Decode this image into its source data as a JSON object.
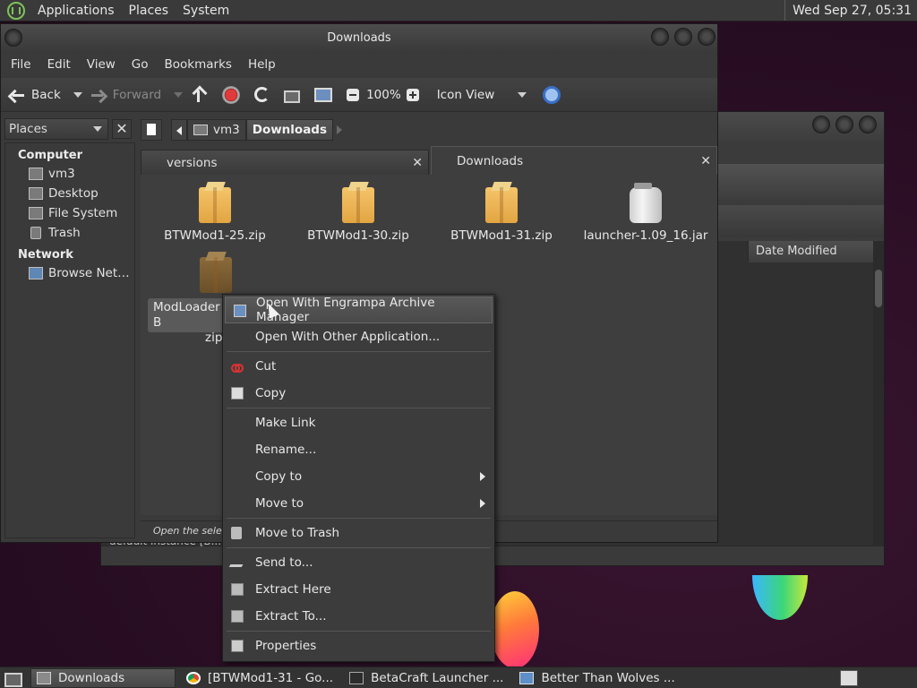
{
  "top_panel": {
    "menus": [
      "Applications",
      "Places",
      "System"
    ],
    "clock": "Wed Sep 27, 05:31"
  },
  "window": {
    "title": "Downloads",
    "menubar": [
      "File",
      "Edit",
      "View",
      "Go",
      "Bookmarks",
      "Help"
    ],
    "toolbar": {
      "back": "Back",
      "forward": "Forward",
      "zoom": "100%",
      "view_mode": "Icon View"
    },
    "places": {
      "selector": "Places",
      "sections": [
        {
          "header": "Computer",
          "items": [
            {
              "label": "vm3",
              "icon": "home-folder-icon"
            },
            {
              "label": "Desktop",
              "icon": "desktop-folder-icon"
            },
            {
              "label": "File System",
              "icon": "drive-icon"
            },
            {
              "label": "Trash",
              "icon": "trash-icon"
            }
          ]
        },
        {
          "header": "Network",
          "items": [
            {
              "label": "Browse Net…",
              "icon": "network-icon"
            }
          ]
        }
      ]
    },
    "location": {
      "crumbs": [
        "vm3",
        "Downloads"
      ]
    },
    "tabs": [
      {
        "label": "versions",
        "active": false
      },
      {
        "label": "Downloads",
        "active": true
      }
    ],
    "files": [
      {
        "name": "BTWMod1-25.zip",
        "icon": "package-icon"
      },
      {
        "name": "BTWMod1-30.zip",
        "icon": "package-icon"
      },
      {
        "name": "BTWMod1-31.zip",
        "icon": "package-icon"
      },
      {
        "name": "launcher-1.09_16.jar",
        "icon": "jar-icon"
      },
      {
        "name_line1": "ModLoader B",
        "name_line2": "zip",
        "icon": "package-icon",
        "selected": true
      }
    ],
    "status": "Open the selecte"
  },
  "background_window": {
    "column_header": "Date Modified",
    "peek_text": "default instance [B..."
  },
  "context_menu": {
    "items": [
      {
        "label": "Open With Engrampa Archive Manager",
        "icon": "archive-manager-icon",
        "hover": true
      },
      {
        "label": "Open With Other Application..."
      },
      {
        "separator": true
      },
      {
        "label": "Cut",
        "icon": "scissors-icon"
      },
      {
        "label": "Copy",
        "icon": "copy-icon"
      },
      {
        "separator": true
      },
      {
        "label": "Make Link"
      },
      {
        "label": "Rename..."
      },
      {
        "label": "Copy to",
        "submenu": true
      },
      {
        "label": "Move to",
        "submenu": true
      },
      {
        "separator": true
      },
      {
        "label": "Move to Trash",
        "icon": "trash-icon"
      },
      {
        "separator": true
      },
      {
        "label": "Send to...",
        "icon": "send-icon"
      },
      {
        "label": "Extract Here",
        "icon": "extract-icon"
      },
      {
        "label": "Extract To...",
        "icon": "extract-icon"
      },
      {
        "separator": true
      },
      {
        "label": "Properties",
        "icon": "properties-icon"
      }
    ]
  },
  "taskbar": {
    "tasks": [
      {
        "label": "Downloads",
        "icon": "folder-icon",
        "active": true
      },
      {
        "label": "[BTWMod1-31 - Go...",
        "icon": "chrome-icon"
      },
      {
        "label": "BetaCraft Launcher ...",
        "icon": "terminal-icon"
      },
      {
        "label": "Better Than Wolves ...",
        "icon": "java-icon"
      }
    ]
  }
}
